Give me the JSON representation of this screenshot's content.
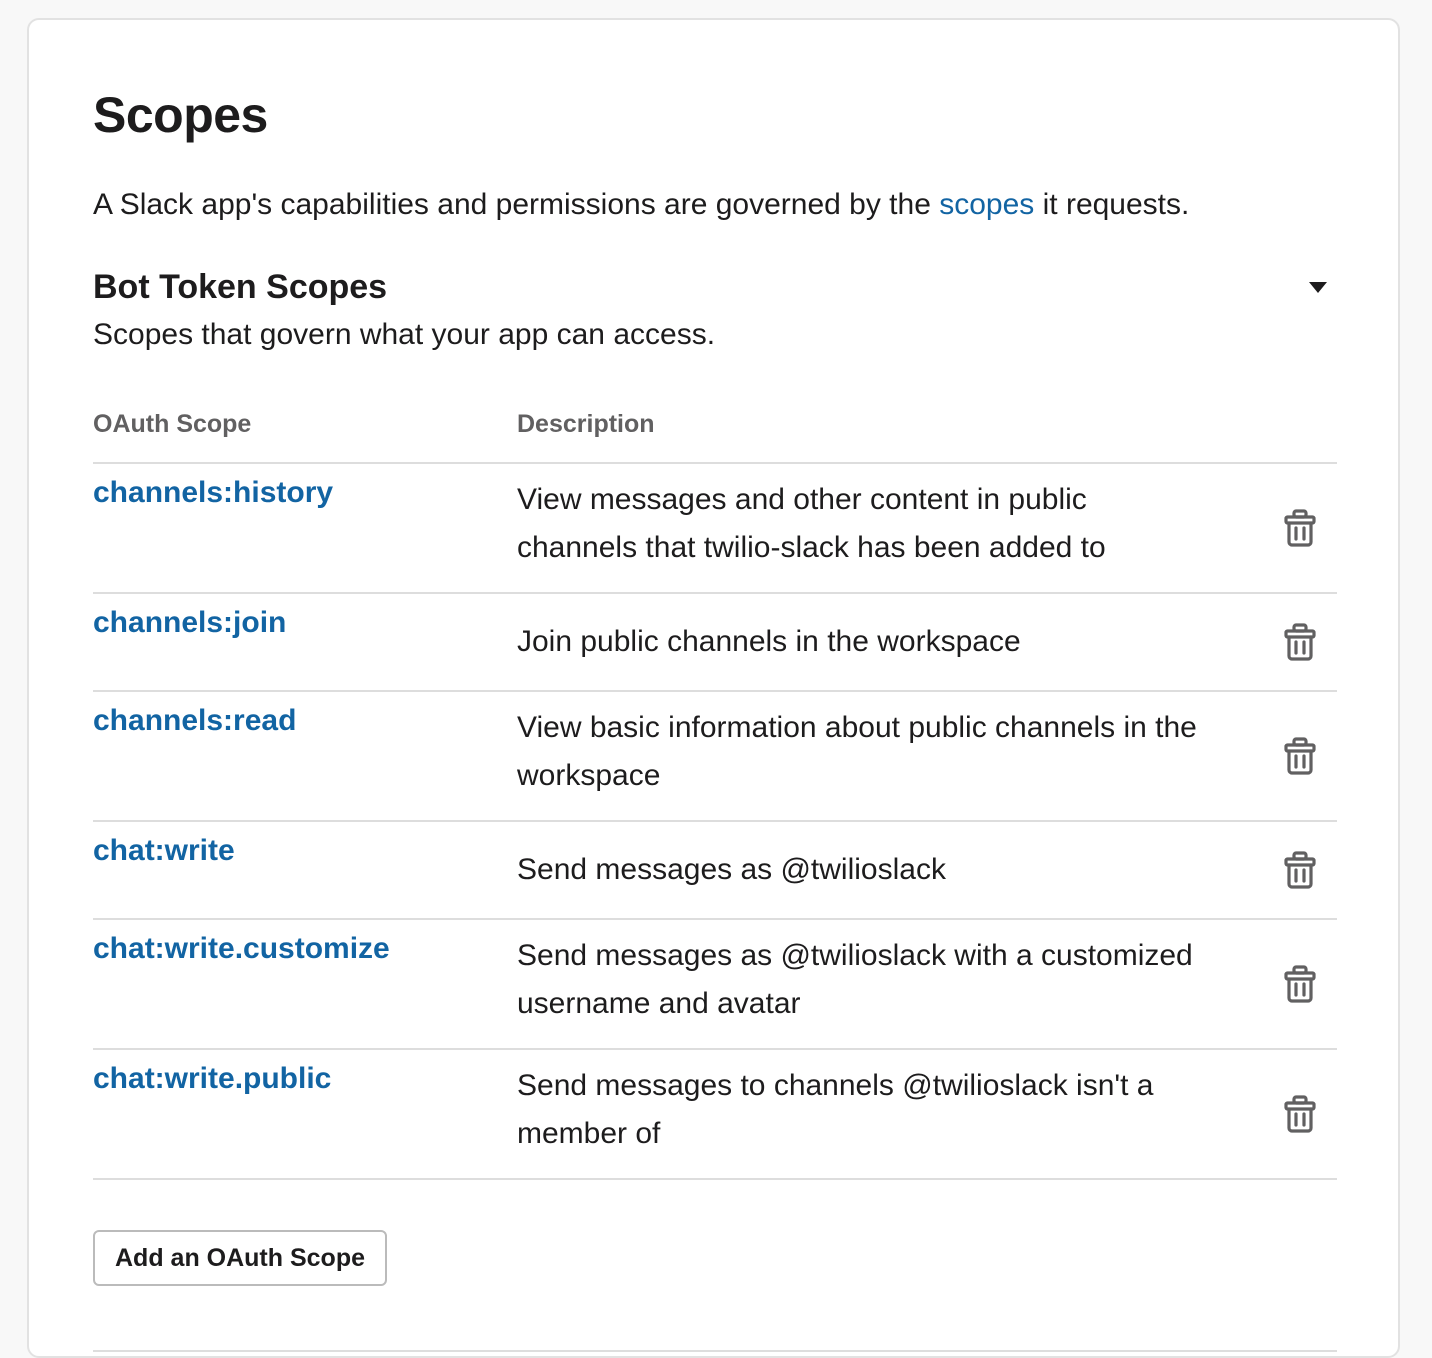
{
  "page": {
    "title": "Scopes",
    "intro": {
      "before": "A Slack app's capabilities and permissions are governed by the ",
      "link": "scopes",
      "after": " it requests."
    }
  },
  "bot_token_scopes": {
    "title": "Bot Token Scopes",
    "description": "Scopes that govern what your app can access.",
    "toggle_icon": "caret-down-icon",
    "columns": {
      "scope": "OAuth Scope",
      "description": "Description"
    },
    "rows": [
      {
        "scope": "channels:history",
        "description": "View messages and other content in public channels that twilio-slack has been added to"
      },
      {
        "scope": "channels:join",
        "description": "Join public channels in the workspace"
      },
      {
        "scope": "channels:read",
        "description": "View basic information about public channels in the workspace"
      },
      {
        "scope": "chat:write",
        "description": "Send messages as @twilioslack"
      },
      {
        "scope": "chat:write.customize",
        "description": "Send messages as @twilioslack with a customized username and avatar"
      },
      {
        "scope": "chat:write.public",
        "description": "Send messages to channels @twilioslack isn't a member of"
      }
    ],
    "row_action_icon": "trash-icon",
    "add_button_label": "Add an OAuth Scope"
  },
  "colors": {
    "link": "#1264a3",
    "text": "#1d1c1d",
    "muted": "#616061",
    "border": "#dddddd"
  }
}
